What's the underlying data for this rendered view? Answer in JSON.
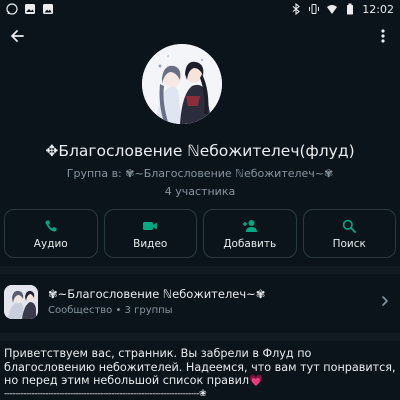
{
  "status_bar": {
    "time": "12:02",
    "left_icons": [
      "whatsapp-icon",
      "image-icon",
      "gallery-icon"
    ],
    "right_icons": [
      "bluetooth-icon",
      "vibrate-icon",
      "wifi-icon",
      "battery-icon"
    ]
  },
  "app_bar": {
    "back_icon": "arrow-left-icon",
    "menu_icon": "more-vertical-icon"
  },
  "group": {
    "name": "✥Благословение ℕебожителеч(флуд)",
    "subtitle": "Группа в: ✾~Благословение ℕебожителеч~✾",
    "members": "4 участника"
  },
  "actions": [
    {
      "label": "Аудио",
      "icon": "phone-icon"
    },
    {
      "label": "Видео",
      "icon": "video-icon"
    },
    {
      "label": "Добавить",
      "icon": "add-person-icon"
    },
    {
      "label": "Поиск",
      "icon": "search-icon"
    }
  ],
  "community": {
    "name": "✾~Благословение ℕебожителеч~✾",
    "meta": "Сообщество • 3 группы",
    "chevron_icon": "chevron-right-icon"
  },
  "description": {
    "text": "Приветствуем вас, странник. Вы забрели в Флуд по благословению небожителей. Надеемся, что вам тут понравится, но перед этим небольшой список правил💗",
    "separator": "-----------------------------------------------------------------------❀"
  },
  "colors": {
    "background": "#0b141a",
    "accent": "#00a884",
    "text_primary": "#e9edef",
    "text_secondary": "#8696a0",
    "divider": "#111b21"
  }
}
